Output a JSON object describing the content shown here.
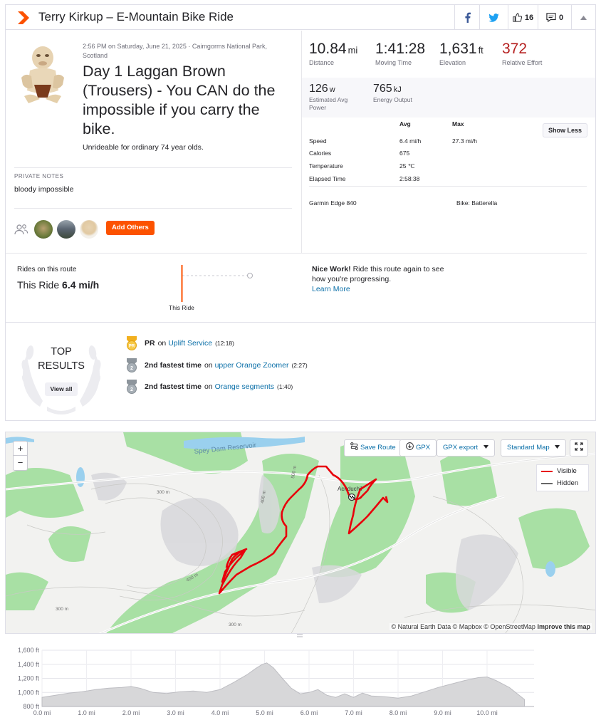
{
  "header": {
    "title": "Terry Kirkup – E-Mountain Bike Ride",
    "kudos_count": "16",
    "comment_count": "0"
  },
  "activity": {
    "meta": "2:56 PM on Saturday, June 21, 2025 · Caimgorms National Park, Scotland",
    "name": "Day 1 Laggan Brown (Trousers) - You CAN do the impossible if you carry the bike.",
    "description": "Unrideable for ordinary 74 year olds.",
    "private_notes_label": "PRIVATE NOTES",
    "private_notes": "bloody impossible",
    "add_others": "Add Others"
  },
  "stats": {
    "distance": {
      "value": "10.84",
      "unit": "mi",
      "label": "Distance"
    },
    "moving_time": {
      "value": "1:41:28",
      "label": "Moving Time"
    },
    "elevation": {
      "value": "1,631",
      "unit": "ft",
      "label": "Elevation"
    },
    "relative_effort": {
      "value": "372",
      "label": "Relative Effort",
      "color": "#b51f1f"
    },
    "power": {
      "value": "126",
      "unit": "w",
      "label": "Estimated Avg Power"
    },
    "energy": {
      "value": "765",
      "unit": "kJ",
      "label": "Energy Output"
    }
  },
  "more_stats": {
    "avg_header": "Avg",
    "max_header": "Max",
    "show_less": "Show Less",
    "rows": [
      {
        "label": "Speed",
        "avg": "6.4 mi/h",
        "max": "27.3 mi/h"
      },
      {
        "label": "Calories",
        "avg": "675",
        "max": ""
      },
      {
        "label": "Temperature",
        "avg": "25 ℃",
        "max": ""
      },
      {
        "label": "Elapsed Time",
        "avg": "2:58:38",
        "max": ""
      }
    ],
    "device": "Garmin Edge 840",
    "bike": "Bike: Batterella"
  },
  "route": {
    "rides_label": "Rides on this route",
    "this_ride_prefix": "This Ride",
    "this_ride_speed": "6.4 mi/h",
    "bar_label": "This Ride",
    "nice_work_bold": "Nice Work!",
    "nice_work_text": "Ride this route again to see how you're progressing.",
    "learn_more": "Learn More"
  },
  "top_results": {
    "title_line1": "TOP",
    "title_line2": "RESULTS",
    "view_all": "View all",
    "items": [
      {
        "badge": "PR",
        "rank": "PR",
        "prep": "on",
        "segment": "Uplift Service",
        "time": "(12:18)"
      },
      {
        "badge": "2",
        "rank": "2nd fastest time",
        "prep": "on",
        "segment": "upper Orange Zoomer",
        "time": "(2:27)"
      },
      {
        "badge": "2",
        "rank": "2nd fastest time",
        "prep": "on",
        "segment": "Orange segments",
        "time": "(1:40)"
      }
    ]
  },
  "map": {
    "save_route": "Save Route",
    "gpx": "GPX",
    "gpx_export": "GPX export",
    "map_style": "Standard Map",
    "legend_visible": "Visible",
    "legend_hidden": "Hidden",
    "visible_color": "#e8000b",
    "hidden_color": "#666666",
    "place_labels": [
      "Spey Dam Reservoir",
      "Achduchil",
      "300 m",
      "400 m",
      "300 m",
      "300 m",
      "400 m",
      "500 m"
    ],
    "attribution": "© Natural Earth Data © Mapbox © OpenStreetMap",
    "improve": "Improve this map"
  },
  "chart_data": {
    "type": "area",
    "x": [
      0.0,
      0.3,
      0.6,
      0.9,
      1.2,
      1.5,
      1.8,
      2.0,
      2.2,
      2.5,
      2.8,
      3.1,
      3.4,
      3.7,
      4.0,
      4.3,
      4.6,
      4.8,
      4.95,
      5.05,
      5.2,
      5.4,
      5.6,
      5.8,
      6.0,
      6.2,
      6.4,
      6.6,
      6.8,
      7.0,
      7.2,
      7.4,
      7.7,
      8.0,
      8.3,
      8.6,
      8.9,
      9.2,
      9.5,
      9.8,
      10.0,
      10.2,
      10.5,
      10.84
    ],
    "y": [
      930,
      960,
      990,
      1010,
      1040,
      1060,
      1070,
      1085,
      1060,
      1000,
      985,
      1010,
      1020,
      1000,
      1040,
      1140,
      1250,
      1340,
      1400,
      1420,
      1350,
      1200,
      1060,
      980,
      1000,
      1040,
      960,
      930,
      980,
      930,
      990,
      950,
      940,
      920,
      950,
      1010,
      1070,
      1120,
      1170,
      1210,
      1220,
      1170,
      1070,
      900
    ],
    "title": "",
    "xlabel": "",
    "ylabel": "",
    "ylim": [
      800,
      1600
    ],
    "xlim": [
      0,
      11
    ],
    "y_ticks": [
      "1,600 ft",
      "1,400 ft",
      "1,200 ft",
      "1,000 ft",
      "800 ft"
    ],
    "y_tick_values": [
      1600,
      1400,
      1200,
      1000,
      800
    ],
    "x_ticks": [
      "0.0 mi",
      "1.0 mi",
      "2.0 mi",
      "3.0 mi",
      "4.0 mi",
      "5.0 mi",
      "6.0 mi",
      "7.0 mi",
      "8.0 mi",
      "9.0 mi",
      "10.0 mi"
    ],
    "x_tick_values": [
      0,
      1,
      2,
      3,
      4,
      5,
      6,
      7,
      8,
      9,
      10
    ],
    "grid": true
  }
}
